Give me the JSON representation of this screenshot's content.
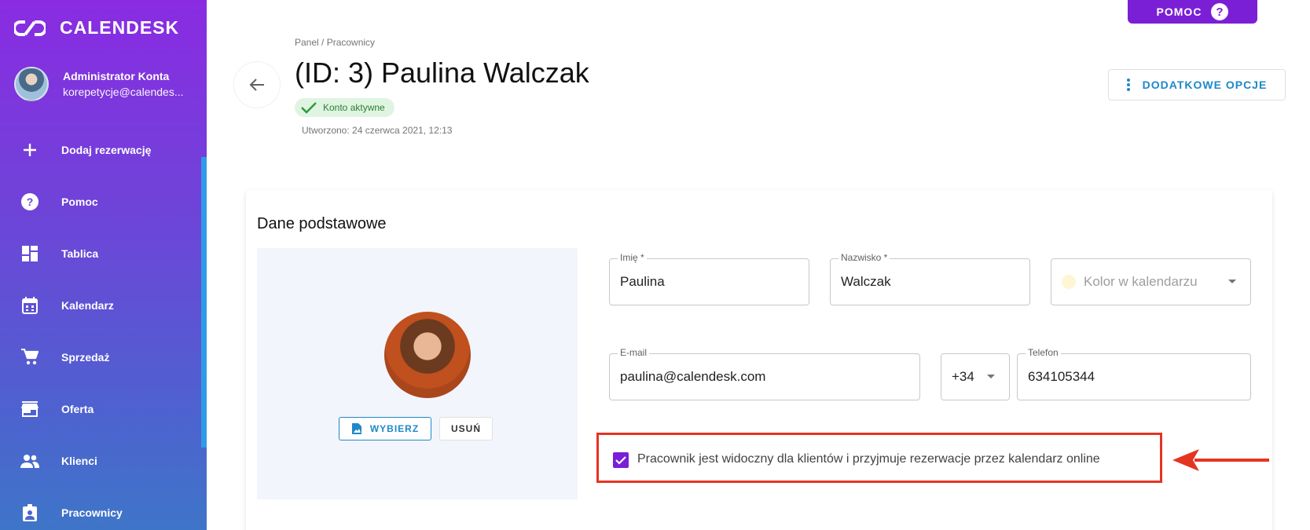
{
  "brand": {
    "name": "CALENDESK"
  },
  "user": {
    "name": "Administrator Konta",
    "email": "korepetycje@calendes..."
  },
  "nav": [
    {
      "label": "Dodaj rezerwację",
      "icon": "plus-icon"
    },
    {
      "label": "Pomoc",
      "icon": "help-circle-icon"
    },
    {
      "label": "Tablica",
      "icon": "dashboard-icon"
    },
    {
      "label": "Kalendarz",
      "icon": "calendar-icon"
    },
    {
      "label": "Sprzedaż",
      "icon": "cart-icon"
    },
    {
      "label": "Oferta",
      "icon": "store-icon"
    },
    {
      "label": "Klienci",
      "icon": "people-icon"
    },
    {
      "label": "Pracownicy",
      "icon": "badge-icon"
    }
  ],
  "header": {
    "help_label": "POMOC",
    "breadcrumb": "Panel / Pracownicy",
    "title": "(ID: 3) Paulina Walczak",
    "status": "Konto aktywne",
    "created": "Utworzono: 24 czerwca 2021, 12:13",
    "extra_options": "DODATKOWE OPCJE"
  },
  "card": {
    "title": "Dane podstawowe",
    "choose_label": "WYBIERZ",
    "remove_label": "USUŃ",
    "fields": {
      "first_name": {
        "label": "Imię *",
        "value": "Paulina"
      },
      "last_name": {
        "label": "Nazwisko *",
        "value": "Walczak"
      },
      "color": {
        "placeholder": "Kolor w kalendarzu"
      },
      "email": {
        "label": "E-mail",
        "value": "paulina@calendesk.com"
      },
      "phone_prefix": {
        "value": "+34"
      },
      "phone": {
        "label": "Telefon",
        "value": "634105344"
      }
    },
    "visible_checkbox": {
      "label": "Pracownik jest widoczny dla klientów i przyjmuje rezerwacje przez kalendarz online",
      "checked": true
    }
  },
  "colors": {
    "accent": "#7b1fd6",
    "link": "#1e88c8",
    "highlight": "#e53422",
    "success": "#2e7d32"
  }
}
